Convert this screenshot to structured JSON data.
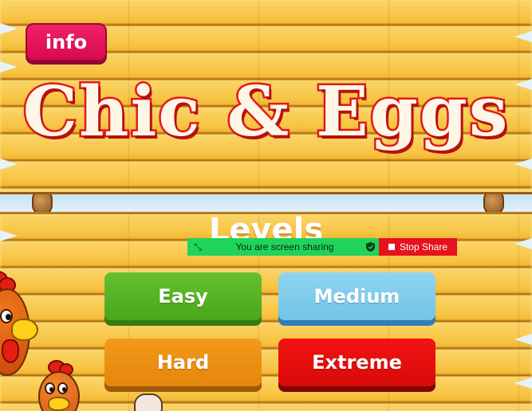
{
  "game": {
    "title": "Chic & Eggs",
    "info_label": "info",
    "levels_heading": "Levels"
  },
  "levels": {
    "easy": "Easy",
    "medium": "Medium",
    "hard": "Hard",
    "extreme": "Extreme"
  },
  "screen_share": {
    "status_text": "You are screen sharing",
    "stop_label": "Stop Share",
    "status_color": "#1fd35c",
    "stop_color": "#e6121e"
  },
  "colors": {
    "title_red": "#e01a1a",
    "info_pink": "#d80a4f",
    "easy_green": "#4aa61b",
    "medium_blue": "#72c4e8",
    "hard_orange": "#e4860c",
    "extreme_red": "#d80a0a",
    "wood_yellow": "#f7c343"
  },
  "icons": {
    "drag": "drag-handle-icon",
    "shield": "shield-check-icon",
    "stop": "stop-square-icon"
  }
}
